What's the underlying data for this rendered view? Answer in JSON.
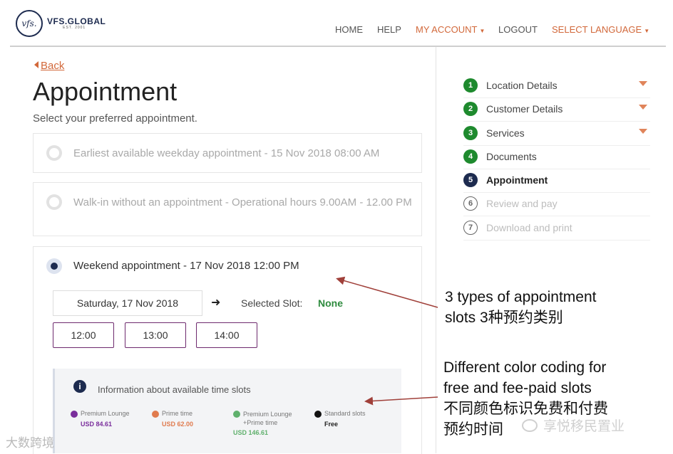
{
  "header": {
    "logo_mark": "vfs.",
    "logo_name": "VFS.GLOBAL",
    "logo_sub": "EST. 2001",
    "nav": {
      "home": "HOME",
      "help": "HELP",
      "my_account": "MY ACCOUNT",
      "logout": "LOGOUT",
      "select_language": "SELECT LANGUAGE"
    }
  },
  "page": {
    "back_label": "Back",
    "title": "Appointment",
    "subtitle": "Select your preferred appointment."
  },
  "options": [
    {
      "label": "Earliest available weekday appointment - 15 Nov 2018 08:00 AM",
      "selected": false
    },
    {
      "label": "Walk-in without an appointment - Operational hours 9.00AM - 12.00 PM",
      "selected": false
    },
    {
      "label": "Weekend appointment - 17 Nov 2018 12:00 PM",
      "selected": true
    }
  ],
  "booking": {
    "date": "Saturday, 17 Nov 2018",
    "selected_slot_label": "Selected Slot:",
    "selected_slot_value": "None",
    "slots": [
      "12:00",
      "13:00",
      "14:00"
    ]
  },
  "info": {
    "title": "Information about available time slots",
    "legend": [
      {
        "name": "Premium Lounge",
        "price": "USD 84.61",
        "color": "#7a2e9c"
      },
      {
        "name": "Prime time",
        "price": "USD 62.00",
        "color": "#e07b4e"
      },
      {
        "name": "Premium Lounge +Prime time",
        "price": "USD 146.61",
        "color": "#5fb06c"
      },
      {
        "name": "Standard slots",
        "price": "Free",
        "color": "#111111"
      }
    ]
  },
  "steps": [
    {
      "num": "1",
      "label": "Location Details",
      "state": "done"
    },
    {
      "num": "2",
      "label": "Customer Details",
      "state": "done"
    },
    {
      "num": "3",
      "label": "Services",
      "state": "done"
    },
    {
      "num": "4",
      "label": "Documents",
      "state": "done"
    },
    {
      "num": "5",
      "label": "Appointment",
      "state": "active"
    },
    {
      "num": "6",
      "label": "Review and pay",
      "state": "todo"
    },
    {
      "num": "7",
      "label": "Download and print",
      "state": "todo"
    }
  ],
  "annotations": {
    "types_en": "3 types of appointment",
    "types_en2": "slots 3种预约类别",
    "color_l1": "Different color coding for",
    "color_l2": "free and fee-paid slots",
    "color_l3": "不同颜色标识免费和付费",
    "color_l4": "预约时间"
  },
  "watermarks": {
    "left": "大数跨境",
    "right": "享悦移民置业"
  },
  "colors": {
    "accent_orange": "#d2683a",
    "navy": "#1d2b4f",
    "step_done": "#1e8a2e"
  }
}
